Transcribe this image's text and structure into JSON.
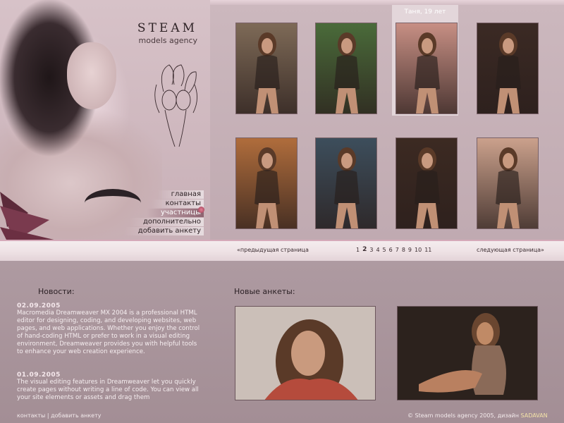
{
  "brand": {
    "title": "STEAM",
    "subtitle": "models agency"
  },
  "menu": [
    {
      "label": "главная"
    },
    {
      "label": "контакты"
    },
    {
      "label": "участницы",
      "active": true
    },
    {
      "label": "дополнительно"
    },
    {
      "label": "добавить анкету"
    }
  ],
  "gallery": {
    "selected_caption": "Таня, 19 лет",
    "thumbs": [
      {
        "bg": "#7e6a57"
      },
      {
        "bg": "#4a6b3a"
      },
      {
        "bg": "#c78f84"
      },
      {
        "bg": "#3b2a24"
      },
      {
        "bg": "#b06d3c"
      },
      {
        "bg": "#3d4e5c"
      },
      {
        "bg": "#3c2a22"
      },
      {
        "bg": "#cba18c"
      }
    ]
  },
  "pager": {
    "prev": "«предыдущая страница",
    "next": "следующая страница»",
    "pages": [
      "1",
      "2",
      "3",
      "4",
      "5",
      "6",
      "7",
      "8",
      "9",
      "10",
      "11"
    ],
    "current": "2"
  },
  "news": {
    "heading": "Новости:",
    "items": [
      {
        "date": "02.09.2005",
        "text": "Macromedia Dreamweaver MX 2004 is a professional HTML editor for designing, coding, and developing websites, web pages, and web applications. Whether you enjoy the control of hand-coding HTML or prefer to work in a visual editing environment, Dreamweaver provides you with helpful tools to enhance your web creation experience."
      },
      {
        "date": "01.09.2005",
        "text": "The visual editing features in Dreamweaver let you quickly create pages without writing a line of code. You can view all your site elements or assets and drag them"
      }
    ]
  },
  "new_profiles": {
    "heading": "Новые анкеты:"
  },
  "footer": {
    "link1": "контакты",
    "separator": "|",
    "link2": "добавить анкету",
    "copyright": "© Steam models agency 2005, дизайн",
    "author": "SADAVAN"
  },
  "colors": {
    "background": "#a28b93",
    "gallery_panel": "#c4aeb5",
    "pager_bar": "#efe3e6",
    "accent_pink": "#d5aab9",
    "menu_active": "#8e6370"
  }
}
